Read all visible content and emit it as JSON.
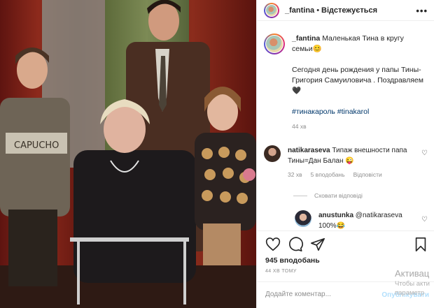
{
  "header": {
    "username": "_fantina",
    "separator": "•",
    "follow_status": "Відстежується",
    "more_icon": "more-horizontal-icon"
  },
  "caption": {
    "username": "_fantina",
    "line1": "Маленькая Тина в кругу семьи😊",
    "line2": "Сегодня день рождения у папы Тины- Григория Самуиловича . Поздравляем 🖤",
    "hashtags": "#тинакароль #tinakarol",
    "time": "44 хв"
  },
  "comments": [
    {
      "username": "natikaraseva",
      "text": "Типаж внешности папа Тины=Дан Балан 😜",
      "time": "32 хв",
      "likes": "5 вподобань",
      "reply": "Відповісти"
    },
    {
      "username": "anustunka",
      "text": "@natikaraseva 100%😂"
    }
  ],
  "hide_replies": "Сховати відповіді",
  "actions": {
    "likes": "945 вподобань",
    "time_ago": "44 ХВ ТОМУ"
  },
  "add_comment": {
    "placeholder": "Додайте коментар...",
    "publish": "Опублікувати"
  },
  "watermark": {
    "line1": "Активац",
    "line2": "Чтобы акти",
    "line3": "параметр"
  },
  "colors": {
    "link": "#00376b",
    "meta": "#8e8e8e",
    "publish_disabled": "#b2dffc",
    "border": "#efefef"
  }
}
